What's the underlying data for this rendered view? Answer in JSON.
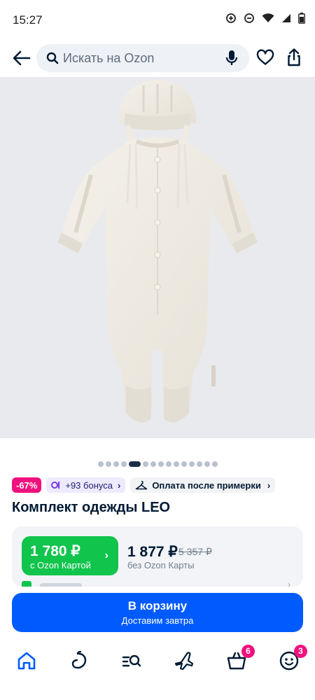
{
  "status_bar": {
    "time": "15:27"
  },
  "search": {
    "placeholder": "Искать на Ozon"
  },
  "gallery": {
    "image_alt": "Комплект одежды LEO",
    "slide_count": 15,
    "active_slide": 4
  },
  "badges": {
    "discount": "-67%",
    "bonus": "+93 бонуса",
    "fitting": "Оплата после примерки"
  },
  "product": {
    "title": "Комплект одежды LEO"
  },
  "price": {
    "ozon_card_price": "1 780 ₽",
    "ozon_card_label": "с Ozon Картой",
    "regular_price": "1 877 ₽",
    "old_price": "5 357 ₽",
    "regular_label": "без Ozon Карты"
  },
  "cart_button": {
    "label": "В корзину",
    "subtitle": "Доставим завтра"
  },
  "bottom_nav": {
    "items": [
      {
        "icon": "home-icon",
        "active": true
      },
      {
        "icon": "fresh-icon"
      },
      {
        "icon": "catalog-search-icon"
      },
      {
        "icon": "travel-icon"
      },
      {
        "icon": "cart-icon",
        "badge": "6"
      },
      {
        "icon": "profile-icon",
        "badge": "3"
      }
    ]
  },
  "colors": {
    "accent": "#005bff",
    "ozon_green": "#10c44c",
    "discount": "#f1117e",
    "text": "#001a34"
  }
}
